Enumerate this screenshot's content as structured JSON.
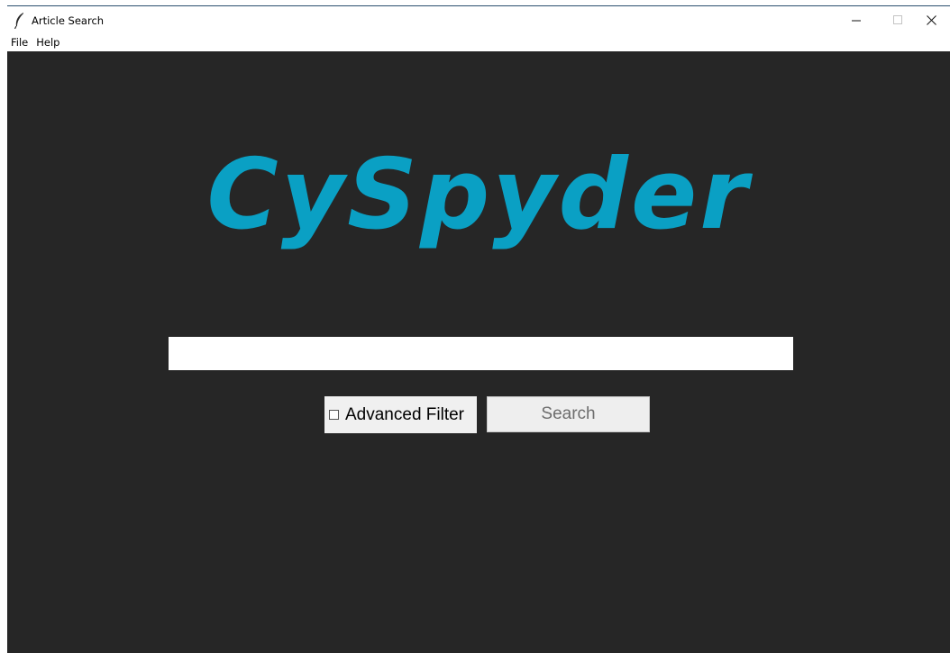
{
  "window": {
    "title": "Article Search",
    "controls": {
      "minimize": "minimize-icon",
      "maximize": "maximize-icon",
      "close": "close-icon"
    }
  },
  "menubar": {
    "items": [
      {
        "label": "File"
      },
      {
        "label": "Help"
      }
    ]
  },
  "logo": {
    "text": "CySpyder",
    "color": "#0aa0c4"
  },
  "search": {
    "value": "",
    "placeholder": ""
  },
  "advanced_filter": {
    "label": "Advanced Filter",
    "checked": false
  },
  "search_button": {
    "label": "Search"
  },
  "colors": {
    "background": "#262626",
    "accent": "#0aa0c4",
    "button_bg": "#eeeeee",
    "button_text": "#6e6e6e"
  }
}
